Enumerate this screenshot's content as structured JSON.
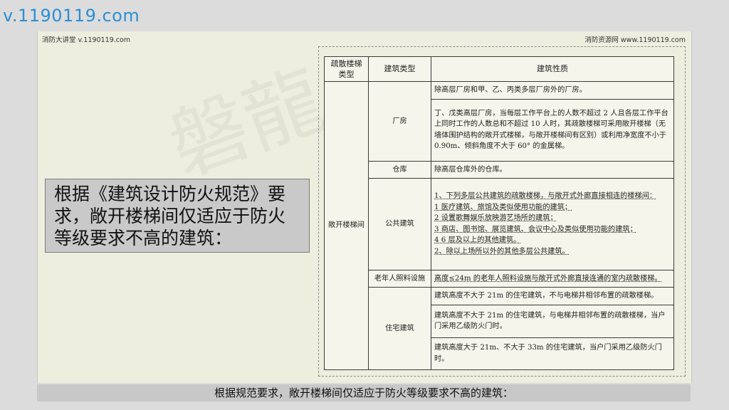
{
  "site_url": "v.1190119.com",
  "slide": {
    "header_left": "消防大讲堂 v.1190119.com",
    "header_right": "消防资源网 www.1190119.com",
    "watermark": "磐龍",
    "callout": "根据《建筑设计防火规范》要求，敞开楼梯间仅适应于防火等级要求不高的建筑："
  },
  "table": {
    "headers": [
      "疏散楼梯类型",
      "建筑类型",
      "建筑性质"
    ],
    "stair_type": "敞开楼梯间",
    "groups": [
      {
        "building_type": "厂房",
        "rows": [
          "除高层厂房和甲、乙、丙类多层厂房外的厂房。",
          "丁、戊类高层厂房，当每层工作平台上的人数不超过 2 人且各层工作平台上同时工作的人数总和不超过 10 人时，其疏散楼梯可采用敞开楼梯（无墙体围护结构的敞开式楼梯，与敞开楼梯间有区别）或利用净宽度不小于 0.90m、倾斜角度不大于 60° 的金属梯。"
        ]
      },
      {
        "building_type": "仓库",
        "rows": [
          "除高层仓库外的仓库。"
        ]
      },
      {
        "building_type": "公共建筑",
        "rows": [
          "1、下列多层公共建筑的疏散楼梯，与敞开式外廊直接相连的楼梯间：\n1 医疗建筑、旅馆及类似使用功能的建筑；\n2 设置歌舞娱乐放映游艺场所的建筑；\n3 商店、图书馆、展览建筑、会议中心及类似使用功能的建筑；\n4 6 层及以上的其他建筑。\n2、除以上场所以外的其他多层公共建筑。"
        ]
      },
      {
        "building_type": "老年人照料设施",
        "rows": [
          "高度≤24m 的老年人照料设施与敞开式外廊直接连通的室内疏散楼梯。"
        ]
      },
      {
        "building_type": "住宅建筑",
        "rows": [
          "建筑高度不大于 21m 的住宅建筑，不与电梯井相邻布置的疏散楼梯。",
          "建筑高度不大于 21m 的住宅建筑，与电梯井相邻布置的疏散楼梯，当户门采用乙级防火门时。",
          "建筑高度大于 21m、不大于 33m 的住宅建筑，当户门采用乙级防火门时。"
        ]
      }
    ]
  },
  "caption": "根据规范要求，敞开楼梯间仅适应于防火等级要求不高的建筑："
}
